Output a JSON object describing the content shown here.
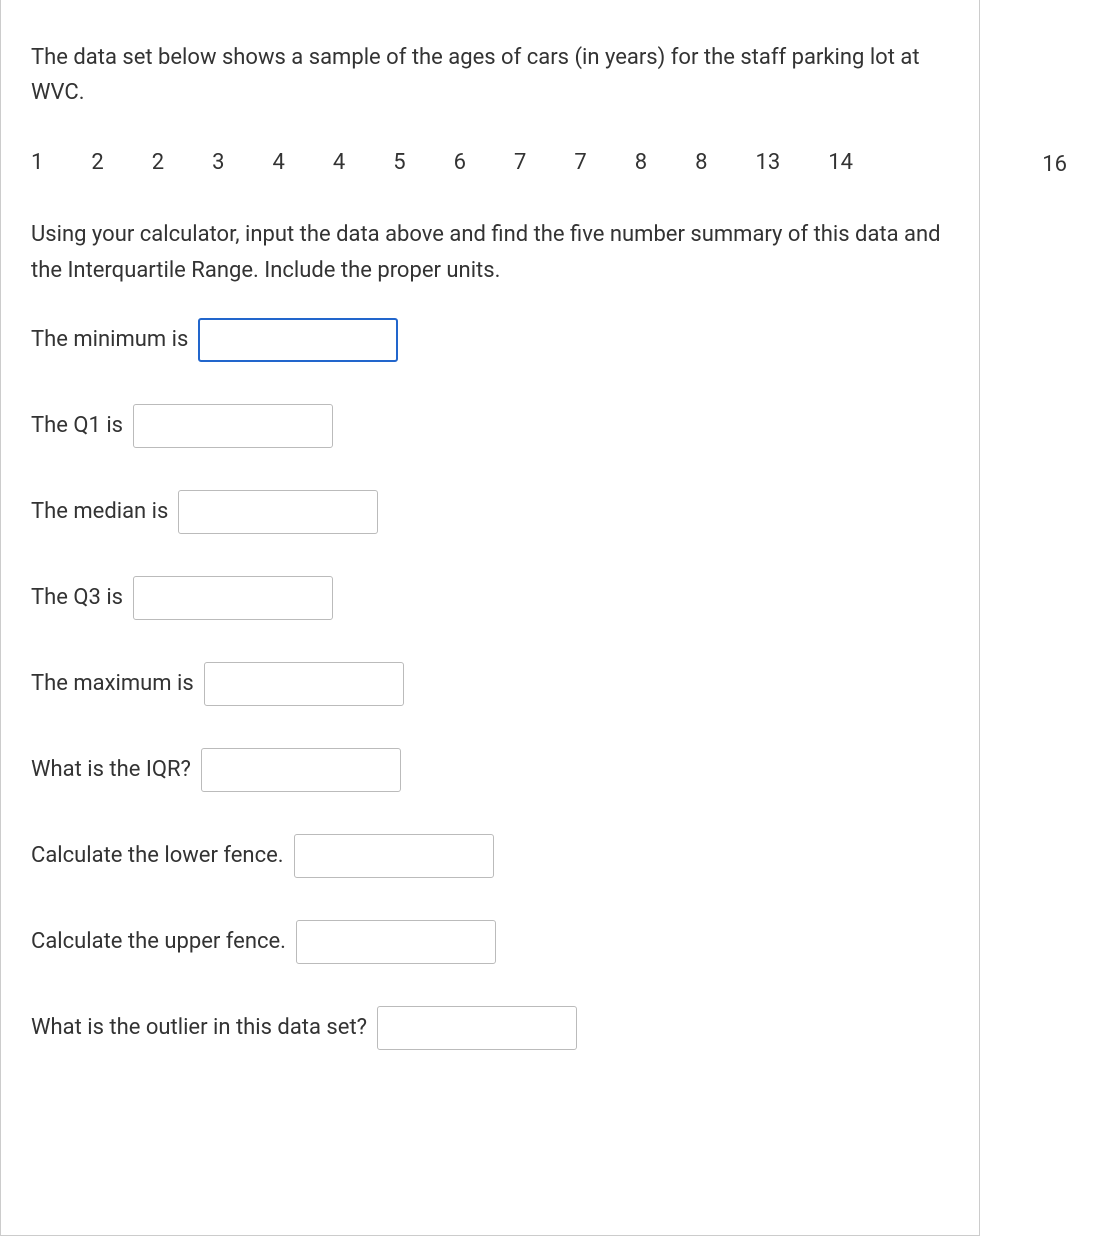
{
  "intro": "The data set below shows a sample of the ages of cars (in years) for the staff parking lot at WVC.",
  "data_values": [
    "1",
    "2",
    "2",
    "3",
    "4",
    "4",
    "5",
    "6",
    "7",
    "7",
    "8",
    "8",
    "13",
    "14"
  ],
  "overflow_value": "16",
  "instruction": "Using your calculator, input the data above and find the five number summary of this data and the Interquartile Range. Include the proper units.",
  "questions": {
    "minimum": "The minimum is",
    "q1": "The Q1 is",
    "median": "The median is",
    "q3": "The Q3 is",
    "maximum": "The maximum is",
    "iqr": "What is the IQR?",
    "lower_fence": "Calculate the lower fence.",
    "upper_fence": "Calculate the upper fence.",
    "outlier": "What is the outlier in this data set?"
  }
}
